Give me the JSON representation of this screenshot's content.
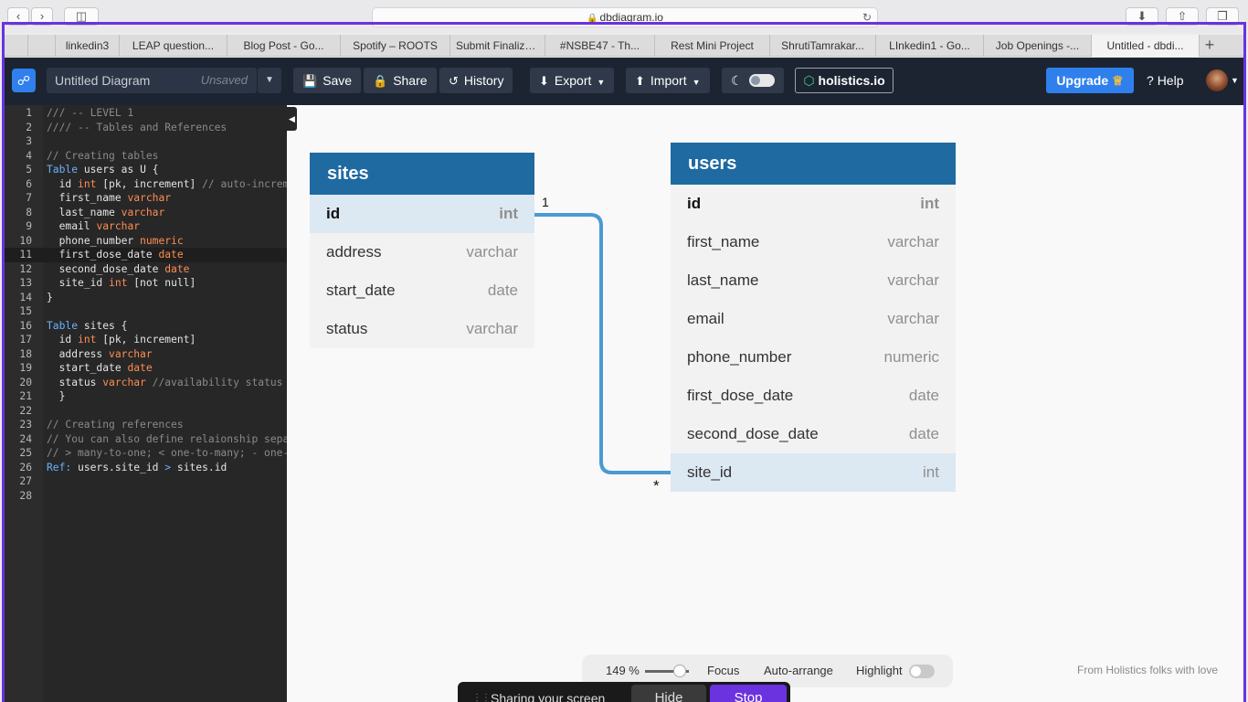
{
  "browser": {
    "url": "dbdiagram.io",
    "tabs": [
      {
        "label": ""
      },
      {
        "label": ""
      },
      {
        "label": "linkedin3"
      },
      {
        "label": "LEAP question..."
      },
      {
        "label": "Blog Post - Go..."
      },
      {
        "label": "Spotify – ROOTS"
      },
      {
        "label": "Submit Finalize..."
      },
      {
        "label": "#NSBE47 - Th..."
      },
      {
        "label": "Rest Mini Project"
      },
      {
        "label": "ShrutiTamrakar..."
      },
      {
        "label": "LInkedin1 - Go..."
      },
      {
        "label": "Job Openings -..."
      },
      {
        "label": "Untitled - dbdi..."
      }
    ],
    "active_tab": 12
  },
  "header": {
    "diagram_name": "Untitled Diagram",
    "status": "Unsaved",
    "save": "Save",
    "share": "Share",
    "history": "History",
    "export": "Export",
    "import": "Import",
    "holistics": "holistics.io",
    "upgrade": "Upgrade",
    "help": "Help"
  },
  "editor": {
    "active_line": 11,
    "lines": [
      {
        "n": "1",
        "t": "/// -- LEVEL 1",
        "k": "cm"
      },
      {
        "n": "2",
        "t": "//// -- Tables and References",
        "k": "cm"
      },
      {
        "n": "3",
        "t": ""
      },
      {
        "n": "4",
        "t": "// Creating tables",
        "k": "cm"
      },
      {
        "n": "5",
        "t": "Table users as U {"
      },
      {
        "n": "6",
        "t": "  id int [pk, increment] // auto-increment"
      },
      {
        "n": "7",
        "t": "  first_name varchar"
      },
      {
        "n": "8",
        "t": "  last_name varchar"
      },
      {
        "n": "9",
        "t": "  email varchar"
      },
      {
        "n": "10",
        "t": "  phone_number numeric"
      },
      {
        "n": "11",
        "t": "  first_dose_date date"
      },
      {
        "n": "12",
        "t": "  second_dose_date date"
      },
      {
        "n": "13",
        "t": "  site_id int [not null]"
      },
      {
        "n": "14",
        "t": "}"
      },
      {
        "n": "15",
        "t": ""
      },
      {
        "n": "16",
        "t": "Table sites {"
      },
      {
        "n": "17",
        "t": "  id int [pk, increment]"
      },
      {
        "n": "18",
        "t": "  address varchar"
      },
      {
        "n": "19",
        "t": "  start_date date"
      },
      {
        "n": "20",
        "t": "  status varchar //availability status"
      },
      {
        "n": "21",
        "t": "  }"
      },
      {
        "n": "22",
        "t": ""
      },
      {
        "n": "23",
        "t": "// Creating references",
        "k": "cm"
      },
      {
        "n": "24",
        "t": "// You can also define relaionship separately",
        "k": "cm"
      },
      {
        "n": "25",
        "t": "// > many-to-one; < one-to-many; - one-to-one",
        "k": "cm"
      },
      {
        "n": "26",
        "t": "Ref: users.site_id > sites.id"
      },
      {
        "n": "27",
        "t": ""
      },
      {
        "n": "28",
        "t": ""
      }
    ]
  },
  "tables": {
    "sites": {
      "name": "sites",
      "fields": [
        {
          "name": "id",
          "type": "int",
          "pk": true,
          "hl": true
        },
        {
          "name": "address",
          "type": "varchar"
        },
        {
          "name": "start_date",
          "type": "date"
        },
        {
          "name": "status",
          "type": "varchar"
        }
      ]
    },
    "users": {
      "name": "users",
      "fields": [
        {
          "name": "id",
          "type": "int",
          "pk": true
        },
        {
          "name": "first_name",
          "type": "varchar"
        },
        {
          "name": "last_name",
          "type": "varchar"
        },
        {
          "name": "email",
          "type": "varchar"
        },
        {
          "name": "phone_number",
          "type": "numeric"
        },
        {
          "name": "first_dose_date",
          "type": "date"
        },
        {
          "name": "second_dose_date",
          "type": "date"
        },
        {
          "name": "site_id",
          "type": "int",
          "hl": true
        }
      ]
    }
  },
  "relation": {
    "one": "1",
    "many": "*"
  },
  "canvas_bar": {
    "zoom": "149 %",
    "focus": "Focus",
    "auto_arrange": "Auto-arrange",
    "highlight": "Highlight"
  },
  "footer_note": "From Holistics folks with love",
  "share_bar": {
    "text": "Sharing your screen",
    "hide": "Hide",
    "stop": "Stop"
  },
  "colors": {
    "accent": "#2f80ed",
    "table_header": "#1e6aa1",
    "relation_line": "#4a9ad4",
    "share_frame": "#6b32e0"
  }
}
